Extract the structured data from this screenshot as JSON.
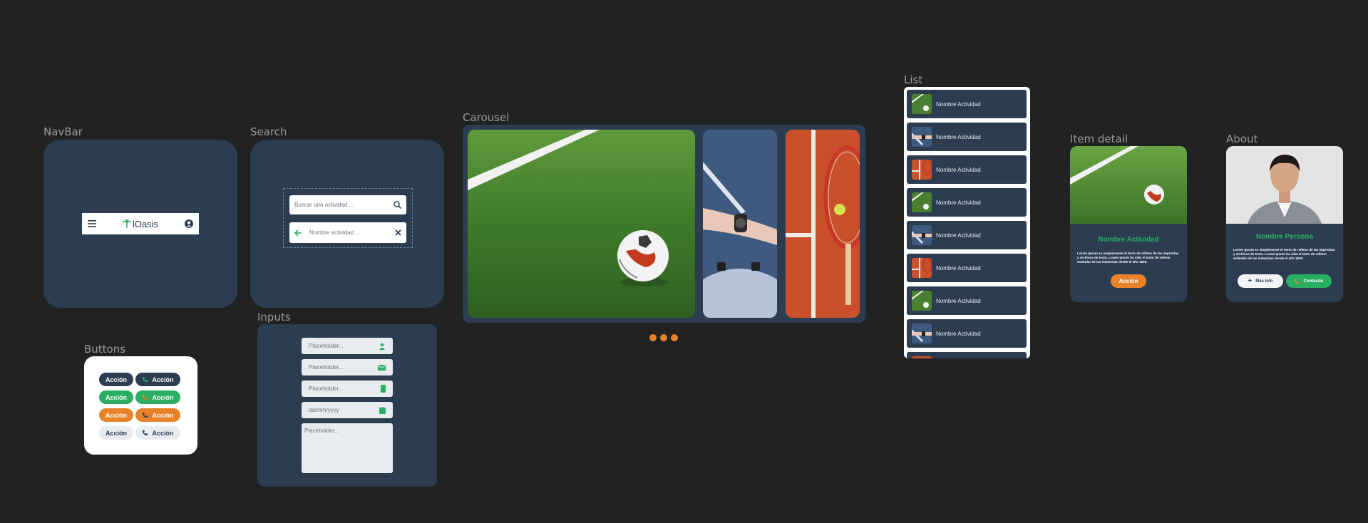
{
  "labels": {
    "navbar": "NavBar",
    "search": "Search",
    "carousel": "Carousel",
    "list": "List",
    "item_detail": "Item detail",
    "about": "About",
    "buttons": "Buttons",
    "inputs": "Inputs"
  },
  "navbar": {
    "logo_text": "lOasis"
  },
  "search": {
    "placeholder": "Buscar una actividad ...",
    "active_value": "Nombre actividad ..."
  },
  "buttons": {
    "rows": [
      {
        "style": "dark",
        "label": "Acción",
        "icon_label": "Acción"
      },
      {
        "style": "green",
        "label": "Acción",
        "icon_label": "Acción"
      },
      {
        "style": "orange",
        "label": "Acción",
        "icon_label": "Acción"
      },
      {
        "style": "light",
        "label": "Acción",
        "icon_label": "Acción"
      }
    ],
    "colors": {
      "dark": "#2c3d52",
      "green": "#2aae62",
      "orange": "#e8822a",
      "light": "#e8ecef"
    }
  },
  "inputs": {
    "user": "Placeholder...",
    "email": "Placeholder...",
    "phone": "Placeholder...",
    "date": "dd/mm/yyyy",
    "textarea": "Placeholder..."
  },
  "carousel": {
    "dots": 3,
    "active_dot_color": "#e8822a"
  },
  "list": {
    "items": [
      {
        "label": "Nombre Actividad",
        "thumb": "grass"
      },
      {
        "label": "Nombre Actividad",
        "thumb": "court"
      },
      {
        "label": "Nombre Actividad",
        "thumb": "clay"
      },
      {
        "label": "Nombre Actividad",
        "thumb": "grass"
      },
      {
        "label": "Nombre Actividad",
        "thumb": "court"
      },
      {
        "label": "Nombre Actividad",
        "thumb": "clay"
      },
      {
        "label": "Nombre Actividad",
        "thumb": "grass"
      },
      {
        "label": "Nombre Actividad",
        "thumb": "court"
      }
    ]
  },
  "item_detail": {
    "title": "Nombre Actividad",
    "body": "Lorem Ipsum es simplemente el texto de relleno de las imprentas y archivos de texto. Lorem Ipsum ha sido el texto de relleno estándar de las industrias desde el año 1500.",
    "action": "Acción"
  },
  "about": {
    "name": "Nombre Persona",
    "body": "Lorem Ipsum es simplemente el texto de relleno de las imprentas y archivos de texto. Lorem Ipsum ha sido el texto de relleno estándar de las industrias desde el año 1500.",
    "more_info": "Más info",
    "contact": "Contactar"
  },
  "theme": {
    "accent_green": "#2aae62",
    "accent_orange": "#e8822a",
    "panel": "#2c3d52",
    "canvas": "#222222"
  }
}
